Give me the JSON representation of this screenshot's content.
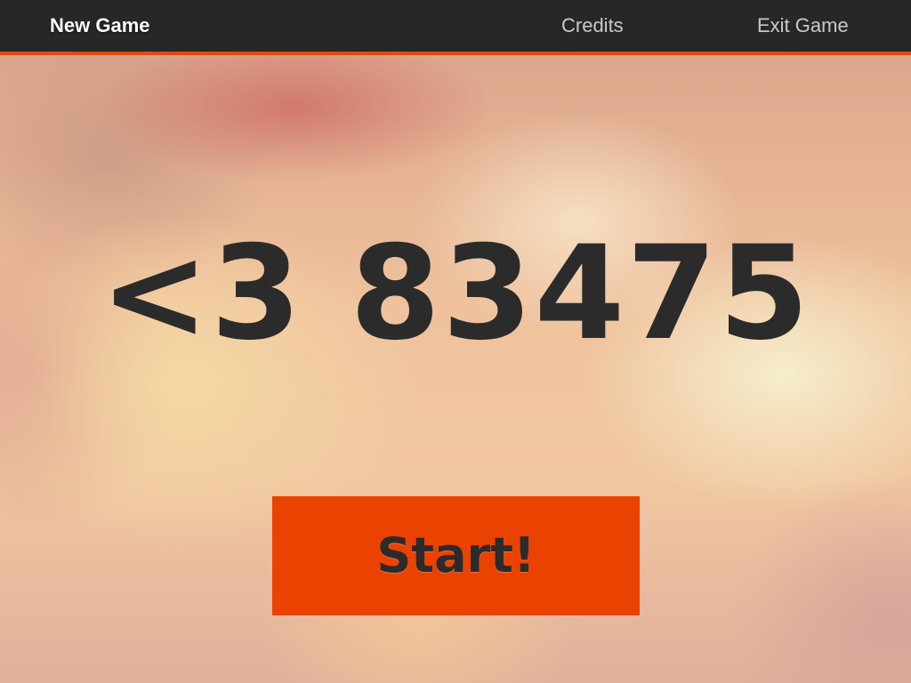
{
  "nav": {
    "items": [
      {
        "label": "New Game",
        "active": true
      },
      {
        "label": "Credits",
        "active": false
      },
      {
        "label": "Exit Game",
        "active": false
      }
    ]
  },
  "main": {
    "code": "<3 83475",
    "start_label": "Start!"
  },
  "colors": {
    "topbar": "#272727",
    "accent": "#ea4200",
    "text_dark": "#2b2b2b",
    "nav_text": "#c9c9c9",
    "nav_active": "#ffffff"
  }
}
